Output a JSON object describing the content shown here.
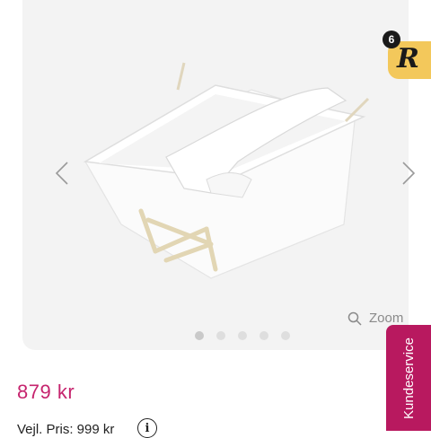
{
  "gallery": {
    "zoom_label": "Zoom",
    "slide_count": 5,
    "active_slide": 1
  },
  "badge": {
    "count": "6",
    "logo_letter": "R",
    "color": "#f3c85b"
  },
  "product": {
    "price": "879 kr",
    "rrp_label": "Vejl. Pris: 999 kr",
    "price_color": "#c6246e"
  },
  "customer_service": {
    "label": "Kundeservice",
    "color": "#b8195f"
  }
}
